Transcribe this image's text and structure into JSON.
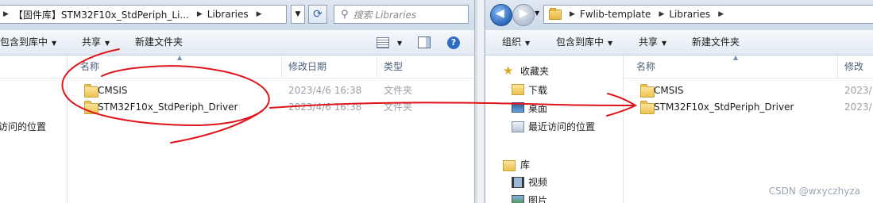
{
  "left": {
    "address_segments": [
      "【固件库】STM32F10x_StdPeriph_Li...",
      "Libraries"
    ],
    "search_placeholder": "搜索 Libraries",
    "toolbar": {
      "include_label": "包含到库中",
      "share_label": "共享",
      "new_folder_label": "新建文件夹"
    },
    "nav_partial": "访问的位置",
    "columns": {
      "name": "名称",
      "date": "修改日期",
      "type": "类型"
    },
    "rows": [
      {
        "name": "CMSIS",
        "date": "2023/4/6 16:38",
        "type": "文件夹"
      },
      {
        "name": "STM32F10x_StdPeriph_Driver",
        "date": "2023/4/6 16:38",
        "type": "文件夹"
      }
    ]
  },
  "right": {
    "address_segments": [
      "Fwlib-template",
      "Libraries"
    ],
    "toolbar": {
      "organize_label": "组织",
      "include_label": "包含到库中",
      "share_label": "共享",
      "new_folder_label": "新建文件夹"
    },
    "nav": {
      "favorites": "收藏夹",
      "downloads": "下载",
      "desktop": "桌面",
      "recent": "最近访问的位置",
      "libraries": "库",
      "videos": "视频",
      "pictures": "图片"
    },
    "columns": {
      "name": "名称",
      "date": "修改"
    },
    "rows": [
      {
        "name": "CMSIS",
        "date": "2023/"
      },
      {
        "name": "STM32F10x_StdPeriph_Driver",
        "date": "2023/"
      }
    ]
  },
  "watermark": "CSDN @wxyczhyza",
  "colors": {
    "annotation": "#e0151b",
    "header_text": "#4c607a",
    "folder": "#ecc351"
  },
  "icons": [
    "folder-icon",
    "search-icon",
    "refresh-icon",
    "back-icon",
    "forward-icon",
    "star-icon",
    "help-icon"
  ]
}
